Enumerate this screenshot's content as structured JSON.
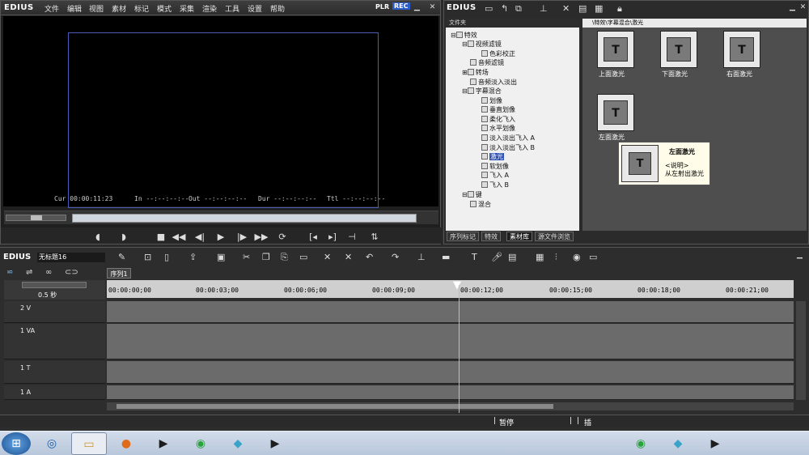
{
  "colors": {
    "accent": "#2c5cc7",
    "selection": "#2a4fb1",
    "playhead": "#99cccc"
  },
  "player": {
    "brand": "EDIUS",
    "menu": [
      "文件",
      "编辑",
      "视图",
      "素材",
      "标记",
      "模式",
      "采集",
      "渲染",
      "工具",
      "设置",
      "帮助"
    ],
    "plr": "PLR",
    "rec": "REC",
    "timecodes": {
      "cur_label": "Cur",
      "cur": "00:00:11:23",
      "in_label": "In",
      "in": "--:--:--:--",
      "out_label": "Out",
      "out": "--:--:--:--",
      "dur_label": "Dur",
      "dur": "--:--:--:--",
      "ttl_label": "Ttl",
      "ttl": "--:--:--:--"
    }
  },
  "library": {
    "brand": "EDIUS",
    "tree_header": "文件夹",
    "tree": [
      {
        "label": "特效"
      },
      {
        "label": "视频滤镜"
      },
      {
        "label": "色彩校正"
      },
      {
        "label": "音频滤镜"
      },
      {
        "label": "转场"
      },
      {
        "label": "音频淡入淡出"
      },
      {
        "label": "字幕混合"
      },
      {
        "label": "划像"
      },
      {
        "label": "垂直划像"
      },
      {
        "label": "柔化飞入"
      },
      {
        "label": "水平划像"
      },
      {
        "label": "淡入淡出飞入 A"
      },
      {
        "label": "淡入淡出飞入 B"
      },
      {
        "label": "激光"
      },
      {
        "label": "软划像"
      },
      {
        "label": "飞入 A"
      },
      {
        "label": "飞入 B"
      },
      {
        "label": "键"
      },
      {
        "label": "混合"
      }
    ],
    "path": "\\特效\\字幕混合\\激光",
    "effects": [
      {
        "label": "上面激光"
      },
      {
        "label": "下面激光"
      },
      {
        "label": "右面激光"
      },
      {
        "label": "左面激光"
      }
    ],
    "tooltip": {
      "title": "左面激光",
      "line1": "<说明>",
      "line2": "从左射出激光"
    },
    "tabs": [
      "序列标记",
      "特效",
      "素材库",
      "源文件浏览"
    ]
  },
  "timeline": {
    "brand": "EDIUS",
    "project_name": "无标题16",
    "sequence_tab": "序列1",
    "zoom": "0.5 秒",
    "ruler": [
      "00:00:00;00",
      "00:00:03;00",
      "00:00:06;00",
      "00:00:09;00",
      "00:00:12;00",
      "00:00:15;00",
      "00:00:18;00",
      "00:00:21;00"
    ],
    "tracks": [
      {
        "name": "2 V"
      },
      {
        "name": "1 VA"
      },
      {
        "name": "1 T"
      },
      {
        "name": "1 A"
      }
    ],
    "status_pause": "暂停",
    "status_insert": "插"
  },
  "taskbar": {
    "apps": [
      "start",
      "media-player",
      "explorer",
      "firefox",
      "edius",
      "ie",
      "notes",
      "edius2"
    ]
  }
}
